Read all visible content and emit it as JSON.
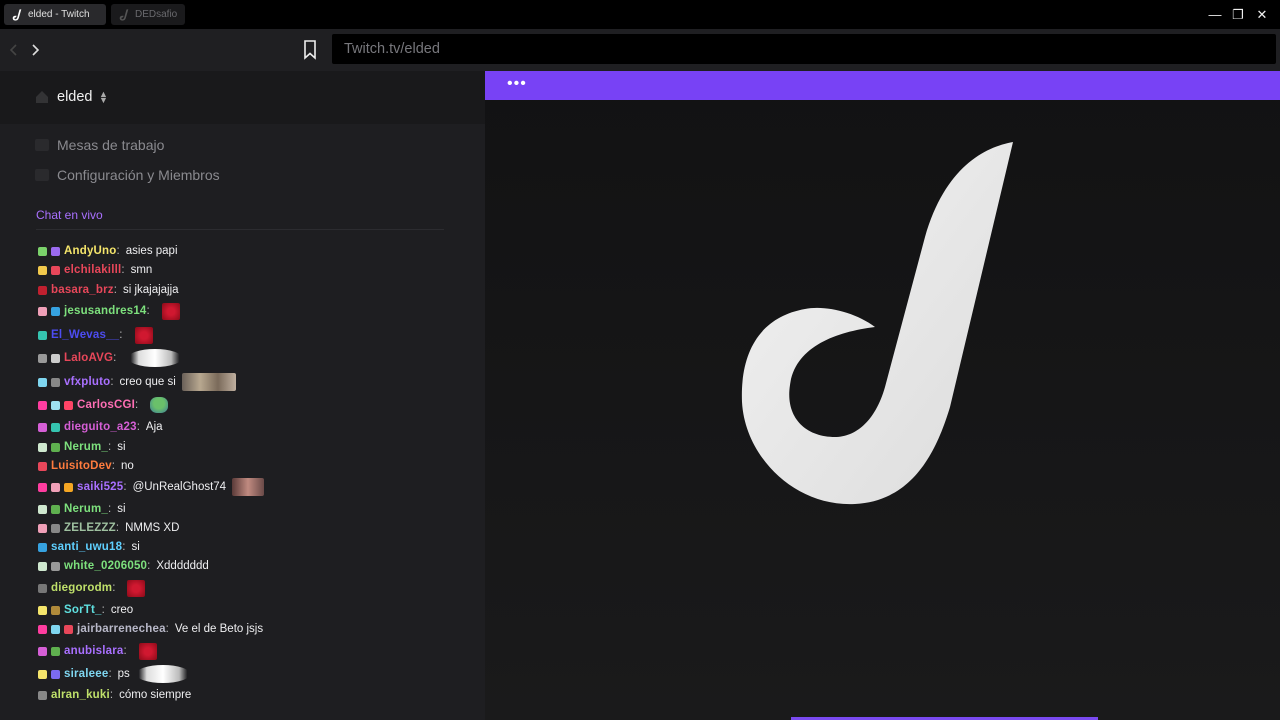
{
  "tabs": [
    {
      "label": "elded - Twitch",
      "active": true
    },
    {
      "label": "DEDsafio",
      "active": false
    }
  ],
  "window_controls": {
    "minimize": "—",
    "restore": "❐",
    "close": "✕"
  },
  "address": {
    "url": "Twitch.tv/elded"
  },
  "workspace": {
    "name": "elded"
  },
  "menu": [
    {
      "label": "Mesas de trabajo"
    },
    {
      "label": "Configuración y Miembros"
    }
  ],
  "chat": {
    "title": "Chat en vivo",
    "messages": [
      {
        "user": "AndyUno",
        "text": "asies papi",
        "color": "#f5e56b",
        "badges": [
          "#7bd26b",
          "#9b6bf0"
        ]
      },
      {
        "user": "elchilakilll",
        "text": "smn",
        "color": "#e8475a",
        "badges": [
          "#f2c94c",
          "#e8475a"
        ]
      },
      {
        "user": "basara_brz",
        "text": "si jkajajajja",
        "color": "#e8475a",
        "badges": [
          "#c0202f"
        ]
      },
      {
        "user": "jesusandres14",
        "text": "",
        "color": "#7de07d",
        "badges": [
          "#f0a0b8",
          "#36a2e0"
        ],
        "emote": "red"
      },
      {
        "user": "El_Wevas__",
        "text": "",
        "color": "#4c4cf0",
        "badges": [
          "#35c4b0"
        ],
        "emote": "red"
      },
      {
        "user": "LaloAVG",
        "text": "",
        "color": "#e8475a",
        "badges": [
          "#999",
          "#ccc"
        ],
        "emote": "cat"
      },
      {
        "user": "vfxpluto",
        "text": "creo que si",
        "color": "#a970ff",
        "badges": [
          "#7fd6f0",
          "#888"
        ],
        "emote": "wide"
      },
      {
        "user": "CarlosCGI",
        "text": "",
        "color": "#ff6eb4",
        "badges": [
          "#ff3da0",
          "#9ee0f0",
          "#ff4466"
        ],
        "emote": "green"
      },
      {
        "user": "dieguito_a23",
        "text": "Aja",
        "color": "#d65fd6",
        "badges": [
          "#d65fd6",
          "#35c4b0"
        ]
      },
      {
        "user": "Nerum_",
        "text": "si",
        "color": "#7de07d",
        "badges": [
          "#cfe8cf",
          "#5fb04f"
        ]
      },
      {
        "user": "LuisitoDev",
        "text": "no",
        "color": "#ff7c3e",
        "badges": [
          "#e8475a"
        ]
      },
      {
        "user": "saiki525",
        "text": "@UnRealGhost74",
        "color": "#a970ff",
        "badges": [
          "#ff3da0",
          "#f0a0b8",
          "#f5a623"
        ],
        "emote": "face"
      },
      {
        "user": "Nerum_",
        "text": "si",
        "color": "#7de07d",
        "badges": [
          "#cfe8cf",
          "#5fb04f"
        ]
      },
      {
        "user": "ZELEZZZ",
        "text": "NMMS XD",
        "color": "#9fc0a0",
        "badges": [
          "#f0a0b8",
          "#888"
        ]
      },
      {
        "user": "santi_uwu18",
        "text": "si",
        "color": "#5fd0ff",
        "badges": [
          "#36a2e0"
        ]
      },
      {
        "user": "white_0206050",
        "text": "Xddddddd",
        "color": "#7de07d",
        "badges": [
          "#cfe8cf",
          "#999"
        ]
      },
      {
        "user": "diegorodm",
        "text": "",
        "color": "#bfe06a",
        "badges": [
          "#777"
        ],
        "emote": "red"
      },
      {
        "user": "SorTt_",
        "text": "creo",
        "color": "#5fe0e0",
        "badges": [
          "#f5e56b",
          "#b08a3a"
        ]
      },
      {
        "user": "jairbarrenechea",
        "text": "Ve el de Beto jsjs",
        "color": "#b8b8c8",
        "badges": [
          "#ff3da0",
          "#7fd6f0",
          "#e8475a"
        ]
      },
      {
        "user": "anubislara",
        "text": "",
        "color": "#a970ff",
        "badges": [
          "#d65fd6",
          "#5fb04f"
        ],
        "emote": "red"
      },
      {
        "user": "siraleee",
        "text": "ps",
        "color": "#7fd6f0",
        "badges": [
          "#f5e56b",
          "#7b6bf0"
        ],
        "emote": "cat"
      },
      {
        "user": "alran_kuki",
        "text": "cómo siempre",
        "color": "#bfe06a",
        "badges": [
          "#888"
        ]
      }
    ]
  },
  "player": {
    "menu_dots": "•••"
  },
  "colors": {
    "accent": "#7842f5",
    "chat_title": "#a970ff"
  }
}
